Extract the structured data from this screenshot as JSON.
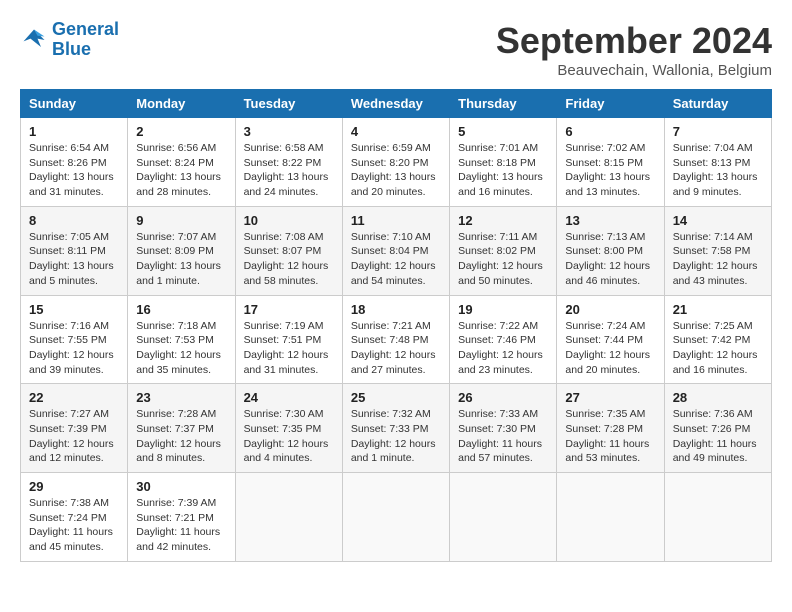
{
  "header": {
    "logo_line1": "General",
    "logo_line2": "Blue",
    "month_title": "September 2024",
    "location": "Beauvechain, Wallonia, Belgium"
  },
  "days_of_week": [
    "Sunday",
    "Monday",
    "Tuesday",
    "Wednesday",
    "Thursday",
    "Friday",
    "Saturday"
  ],
  "weeks": [
    [
      {
        "day": "1",
        "info": "Sunrise: 6:54 AM\nSunset: 8:26 PM\nDaylight: 13 hours\nand 31 minutes."
      },
      {
        "day": "2",
        "info": "Sunrise: 6:56 AM\nSunset: 8:24 PM\nDaylight: 13 hours\nand 28 minutes."
      },
      {
        "day": "3",
        "info": "Sunrise: 6:58 AM\nSunset: 8:22 PM\nDaylight: 13 hours\nand 24 minutes."
      },
      {
        "day": "4",
        "info": "Sunrise: 6:59 AM\nSunset: 8:20 PM\nDaylight: 13 hours\nand 20 minutes."
      },
      {
        "day": "5",
        "info": "Sunrise: 7:01 AM\nSunset: 8:18 PM\nDaylight: 13 hours\nand 16 minutes."
      },
      {
        "day": "6",
        "info": "Sunrise: 7:02 AM\nSunset: 8:15 PM\nDaylight: 13 hours\nand 13 minutes."
      },
      {
        "day": "7",
        "info": "Sunrise: 7:04 AM\nSunset: 8:13 PM\nDaylight: 13 hours\nand 9 minutes."
      }
    ],
    [
      {
        "day": "8",
        "info": "Sunrise: 7:05 AM\nSunset: 8:11 PM\nDaylight: 13 hours\nand 5 minutes."
      },
      {
        "day": "9",
        "info": "Sunrise: 7:07 AM\nSunset: 8:09 PM\nDaylight: 13 hours\nand 1 minute."
      },
      {
        "day": "10",
        "info": "Sunrise: 7:08 AM\nSunset: 8:07 PM\nDaylight: 12 hours\nand 58 minutes."
      },
      {
        "day": "11",
        "info": "Sunrise: 7:10 AM\nSunset: 8:04 PM\nDaylight: 12 hours\nand 54 minutes."
      },
      {
        "day": "12",
        "info": "Sunrise: 7:11 AM\nSunset: 8:02 PM\nDaylight: 12 hours\nand 50 minutes."
      },
      {
        "day": "13",
        "info": "Sunrise: 7:13 AM\nSunset: 8:00 PM\nDaylight: 12 hours\nand 46 minutes."
      },
      {
        "day": "14",
        "info": "Sunrise: 7:14 AM\nSunset: 7:58 PM\nDaylight: 12 hours\nand 43 minutes."
      }
    ],
    [
      {
        "day": "15",
        "info": "Sunrise: 7:16 AM\nSunset: 7:55 PM\nDaylight: 12 hours\nand 39 minutes."
      },
      {
        "day": "16",
        "info": "Sunrise: 7:18 AM\nSunset: 7:53 PM\nDaylight: 12 hours\nand 35 minutes."
      },
      {
        "day": "17",
        "info": "Sunrise: 7:19 AM\nSunset: 7:51 PM\nDaylight: 12 hours\nand 31 minutes."
      },
      {
        "day": "18",
        "info": "Sunrise: 7:21 AM\nSunset: 7:48 PM\nDaylight: 12 hours\nand 27 minutes."
      },
      {
        "day": "19",
        "info": "Sunrise: 7:22 AM\nSunset: 7:46 PM\nDaylight: 12 hours\nand 23 minutes."
      },
      {
        "day": "20",
        "info": "Sunrise: 7:24 AM\nSunset: 7:44 PM\nDaylight: 12 hours\nand 20 minutes."
      },
      {
        "day": "21",
        "info": "Sunrise: 7:25 AM\nSunset: 7:42 PM\nDaylight: 12 hours\nand 16 minutes."
      }
    ],
    [
      {
        "day": "22",
        "info": "Sunrise: 7:27 AM\nSunset: 7:39 PM\nDaylight: 12 hours\nand 12 minutes."
      },
      {
        "day": "23",
        "info": "Sunrise: 7:28 AM\nSunset: 7:37 PM\nDaylight: 12 hours\nand 8 minutes."
      },
      {
        "day": "24",
        "info": "Sunrise: 7:30 AM\nSunset: 7:35 PM\nDaylight: 12 hours\nand 4 minutes."
      },
      {
        "day": "25",
        "info": "Sunrise: 7:32 AM\nSunset: 7:33 PM\nDaylight: 12 hours\nand 1 minute."
      },
      {
        "day": "26",
        "info": "Sunrise: 7:33 AM\nSunset: 7:30 PM\nDaylight: 11 hours\nand 57 minutes."
      },
      {
        "day": "27",
        "info": "Sunrise: 7:35 AM\nSunset: 7:28 PM\nDaylight: 11 hours\nand 53 minutes."
      },
      {
        "day": "28",
        "info": "Sunrise: 7:36 AM\nSunset: 7:26 PM\nDaylight: 11 hours\nand 49 minutes."
      }
    ],
    [
      {
        "day": "29",
        "info": "Sunrise: 7:38 AM\nSunset: 7:24 PM\nDaylight: 11 hours\nand 45 minutes."
      },
      {
        "day": "30",
        "info": "Sunrise: 7:39 AM\nSunset: 7:21 PM\nDaylight: 11 hours\nand 42 minutes."
      },
      {
        "day": "",
        "info": ""
      },
      {
        "day": "",
        "info": ""
      },
      {
        "day": "",
        "info": ""
      },
      {
        "day": "",
        "info": ""
      },
      {
        "day": "",
        "info": ""
      }
    ]
  ]
}
